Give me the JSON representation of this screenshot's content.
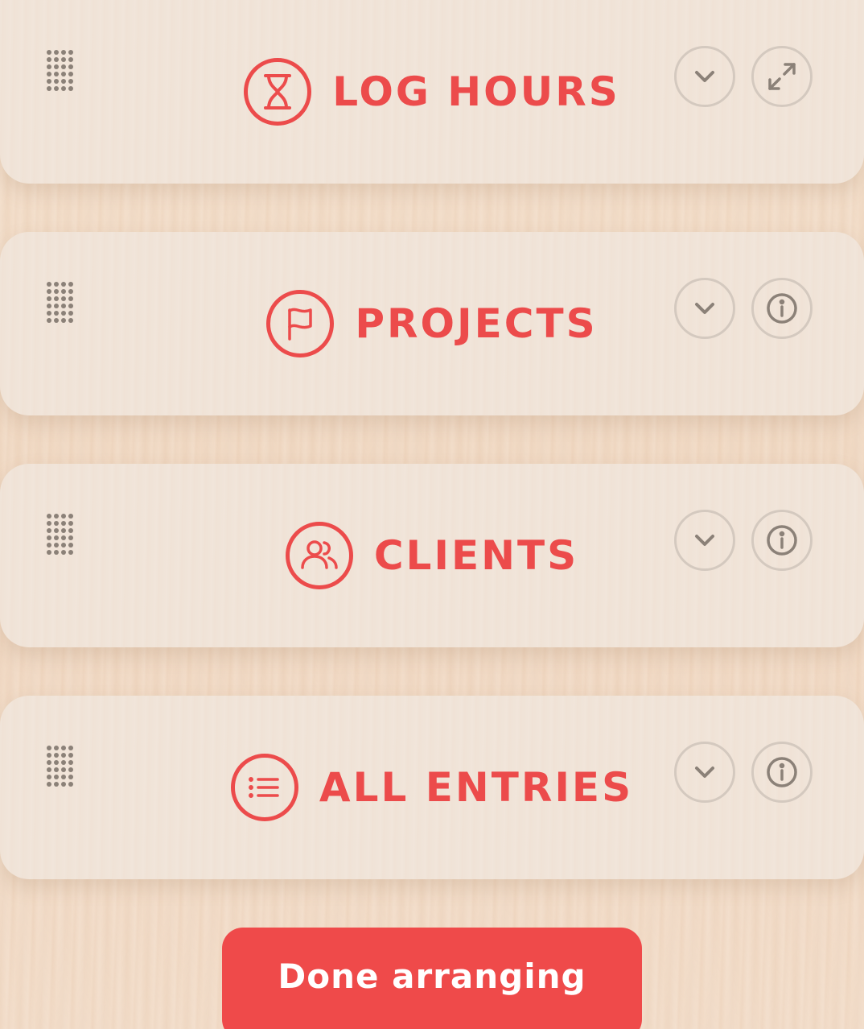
{
  "colors": {
    "accent": "#ec4b4b",
    "button_bg": "#ef4a4a",
    "icon_muted": "#8b8178",
    "card_bg": "#f1e5da"
  },
  "widgets": [
    {
      "title": "LOG HOURS",
      "title_icon": "hourglass-icon",
      "actions": [
        "chevron-down-icon",
        "expand-icon"
      ]
    },
    {
      "title": "PROJECTS",
      "title_icon": "flag-icon",
      "actions": [
        "chevron-down-icon",
        "info-icon"
      ]
    },
    {
      "title": "CLIENTS",
      "title_icon": "users-icon",
      "actions": [
        "chevron-down-icon",
        "info-icon"
      ]
    },
    {
      "title": "ALL ENTRIES",
      "title_icon": "list-icon",
      "actions": [
        "chevron-down-icon",
        "info-icon"
      ]
    }
  ],
  "done_button": {
    "label": "Done arranging"
  }
}
